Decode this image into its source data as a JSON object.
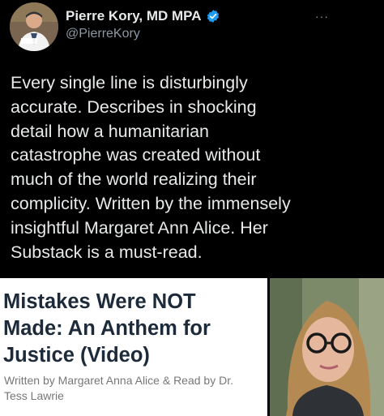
{
  "author": {
    "display_name": "Pierre Kory, MD MPA",
    "handle": "@PierreKory",
    "verified_icon": "verified-badge-icon",
    "avatar_icon": "profile-photo"
  },
  "tweet": {
    "text_lines": [
      "Every single line is disturbingly",
      "accurate. Describes in shocking",
      "detail how a humanitarian",
      "catastrophe was created without",
      "much of the world realizing their",
      "complicity. Written by the immensely",
      "insightful Margaret Ann Alice. Her",
      "Substack is a must-read."
    ],
    "more_label": "···"
  },
  "card": {
    "title_lines": [
      "Mistakes Were NOT",
      "Made: An Anthem for",
      "Justice (Video)"
    ],
    "byline_lines": [
      "Written by Margaret Anna Alice & Read by Dr.",
      "Tess Lawrie"
    ],
    "image_icon": "author-portrait-photo"
  },
  "colors": {
    "background": "#000000",
    "text": "#e7e9ea",
    "secondary": "#8b98a5",
    "verified": "#1d9bf0",
    "card_title": "#1c2a39"
  }
}
